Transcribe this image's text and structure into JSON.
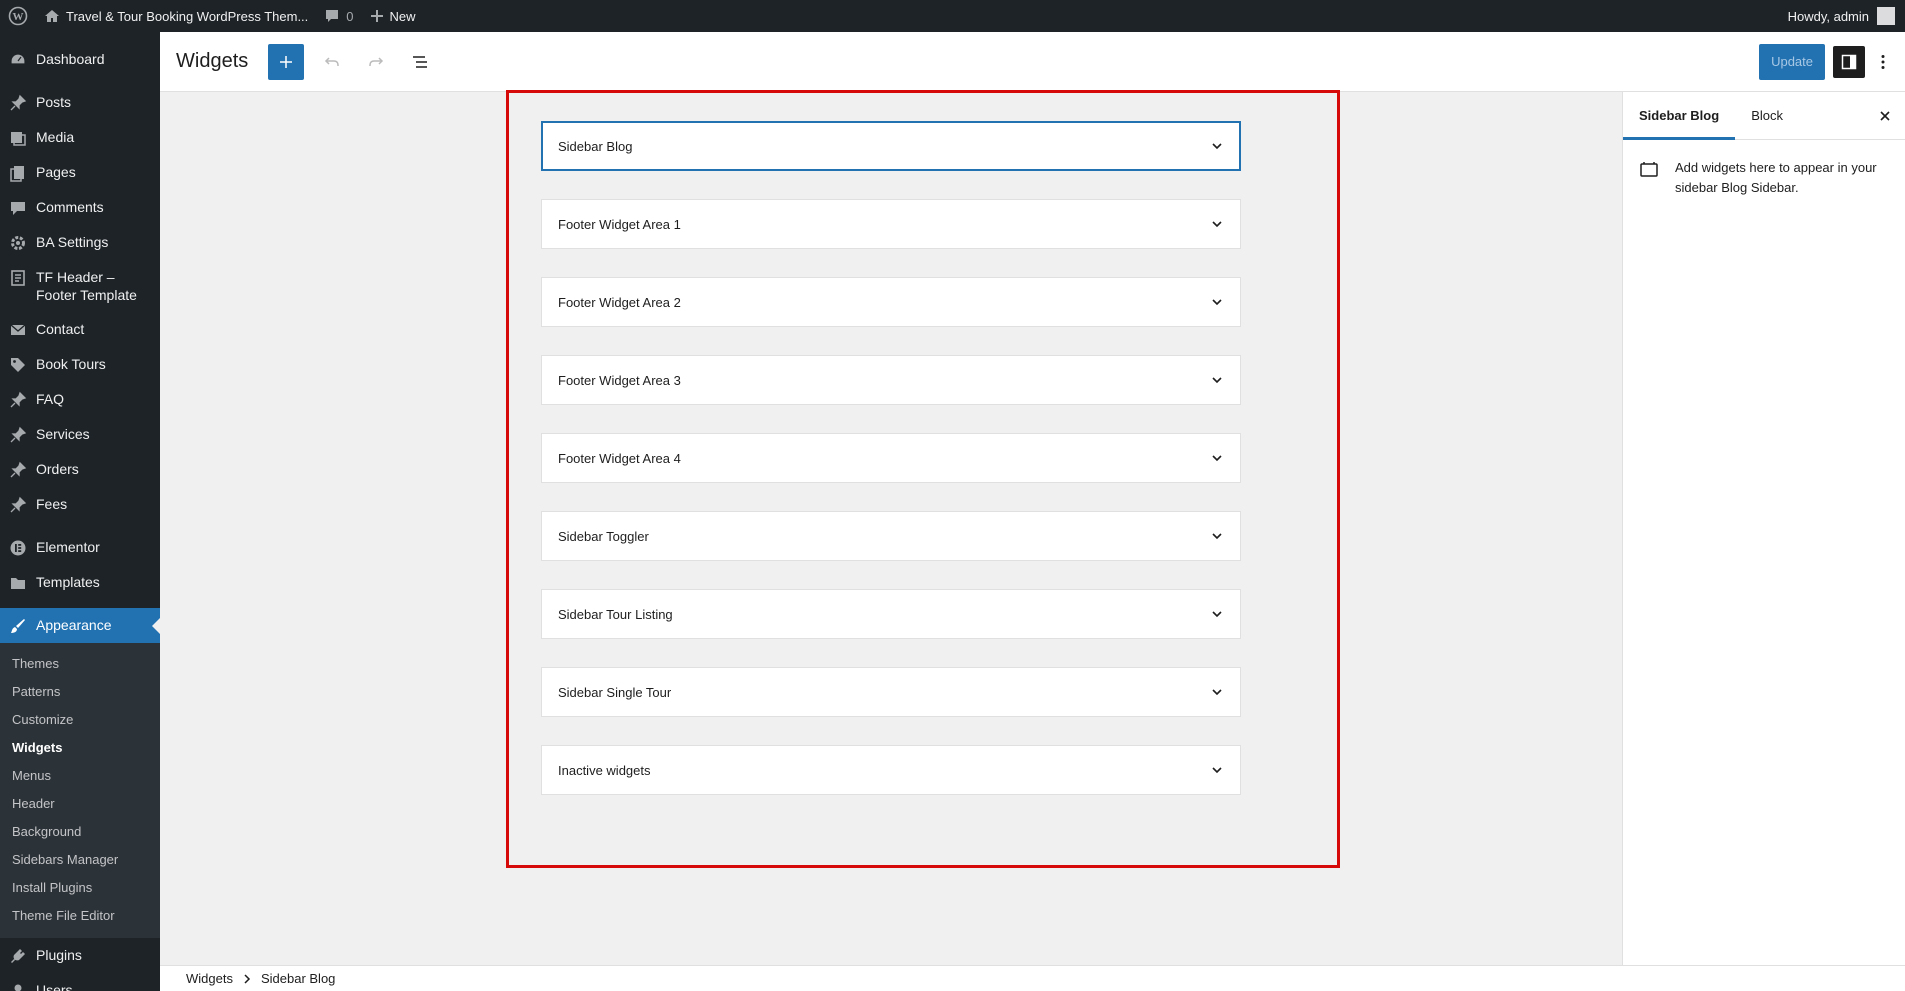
{
  "admin_bar": {
    "site_name": "Travel & Tour Booking WordPress Them...",
    "comments_count": "0",
    "new_label": "New",
    "howdy": "Howdy, admin"
  },
  "menu": {
    "items": [
      {
        "label": "Dashboard",
        "icon": "dashboard-icon"
      },
      {
        "label": "Posts",
        "icon": "pin-icon"
      },
      {
        "label": "Media",
        "icon": "media-icon"
      },
      {
        "label": "Pages",
        "icon": "pages-icon"
      },
      {
        "label": "Comments",
        "icon": "comment-icon"
      },
      {
        "label": "BA Settings",
        "icon": "gear-icon"
      },
      {
        "label": "TF Header – Footer Template",
        "icon": "document-icon"
      },
      {
        "label": "Contact",
        "icon": "mail-icon"
      },
      {
        "label": "Book Tours",
        "icon": "tag-icon"
      },
      {
        "label": "FAQ",
        "icon": "pin-icon"
      },
      {
        "label": "Services",
        "icon": "pin-icon"
      },
      {
        "label": "Orders",
        "icon": "pin-icon"
      },
      {
        "label": "Fees",
        "icon": "pin-icon"
      },
      {
        "label": "Elementor",
        "icon": "elementor-icon"
      },
      {
        "label": "Templates",
        "icon": "folder-icon"
      },
      {
        "label": "Appearance",
        "icon": "brush-icon"
      },
      {
        "label": "Plugins",
        "icon": "plugin-icon"
      },
      {
        "label": "Users",
        "icon": "user-icon"
      }
    ],
    "appearance_submenu": [
      "Themes",
      "Patterns",
      "Customize",
      "Widgets",
      "Menus",
      "Header",
      "Background",
      "Sidebars Manager",
      "Install Plugins",
      "Theme File Editor"
    ]
  },
  "header": {
    "title": "Widgets",
    "update_label": "Update"
  },
  "widget_areas": [
    "Sidebar Blog",
    "Footer Widget Area 1",
    "Footer Widget Area 2",
    "Footer Widget Area 3",
    "Footer Widget Area 4",
    "Sidebar Toggler",
    "Sidebar Tour Listing",
    "Sidebar Single Tour",
    "Inactive widgets"
  ],
  "panel": {
    "tabs": [
      "Sidebar Blog",
      "Block"
    ],
    "description": "Add widgets here to appear in your sidebar Blog Sidebar."
  },
  "breadcrumb": [
    "Widgets",
    "Sidebar Blog"
  ],
  "colors": {
    "accent": "#2271b1",
    "admin_dark": "#1d2327",
    "highlight": "#d70a0a"
  }
}
